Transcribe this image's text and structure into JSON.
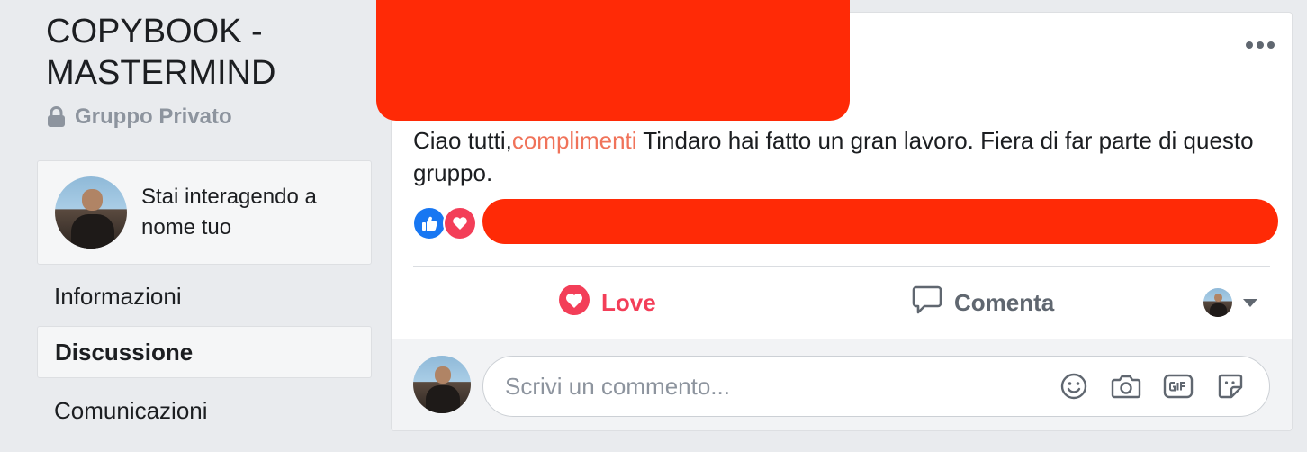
{
  "group": {
    "title": "COPYBOOK - MASTERMIND",
    "privacy": "Gruppo Privato"
  },
  "acting_as": {
    "text": "Stai interagendo a nome tuo"
  },
  "nav": [
    {
      "label": "Informazioni",
      "active": false
    },
    {
      "label": "Discussione",
      "active": true
    },
    {
      "label": "Comunicazioni",
      "active": false
    }
  ],
  "post": {
    "text_before": "Ciao tutti,",
    "text_highlight": "complimenti",
    "text_after": " Tindaro hai fatto un gran lavoro. Fiera di far parte di questo gruppo.",
    "reactions": [
      "like-reaction-icon",
      "love-reaction-icon"
    ]
  },
  "actions": {
    "love_label": "Love",
    "comment_label": "Comenta"
  },
  "comment": {
    "placeholder": "Scrivi un commento...",
    "icons": [
      "emoji-icon",
      "camera-icon",
      "gif-icon",
      "sticker-icon"
    ]
  },
  "colors": {
    "page_bg": "#e9ebee",
    "redaction": "#ff2a06",
    "love": "#f33e58",
    "like": "#1877f2",
    "highlight": "#f0735a"
  }
}
